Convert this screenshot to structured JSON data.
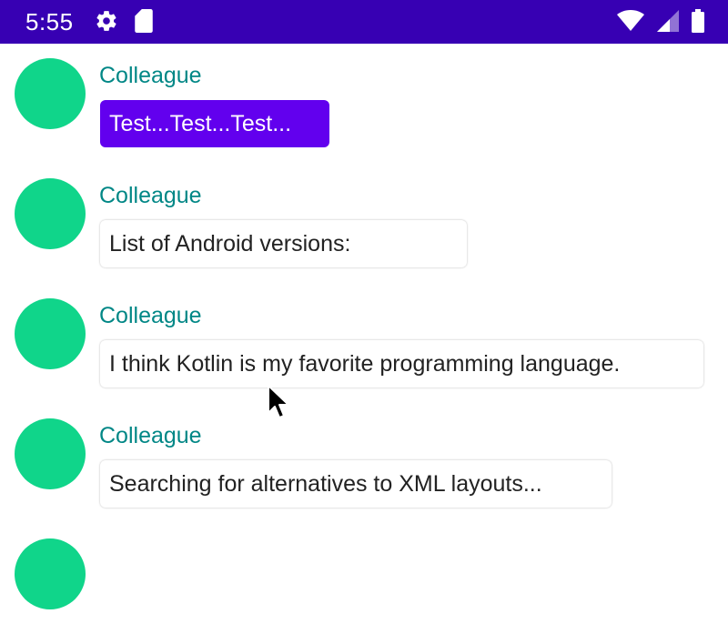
{
  "status_bar": {
    "time": "5:55",
    "left_icons": [
      "gear-icon",
      "sd-card-icon"
    ],
    "right_icons": [
      "wifi-icon",
      "cell-signal-icon",
      "battery-icon"
    ],
    "color": "#3700b3"
  },
  "messages": [
    {
      "author": "Colleague",
      "text": "Test...Test...Test...",
      "highlighted": true
    },
    {
      "author": "Colleague",
      "text": "List of Android versions:",
      "highlighted": false
    },
    {
      "author": "Colleague",
      "text": "I think Kotlin is my favorite programming language.",
      "highlighted": false
    },
    {
      "author": "Colleague",
      "text": "Searching for alternatives to XML layouts...",
      "highlighted": false
    }
  ],
  "colors": {
    "avatar": "#10d58a",
    "author": "#018786",
    "highlight_bubble": "#6200ee"
  }
}
